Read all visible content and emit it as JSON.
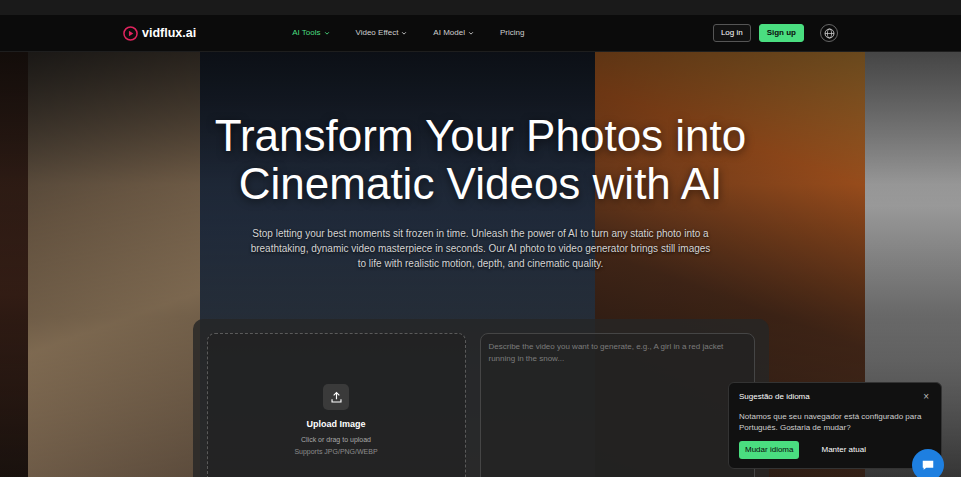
{
  "logo": {
    "text": "vidflux.ai"
  },
  "nav": [
    {
      "label": "AI Tools",
      "selected": true,
      "has_menu": true
    },
    {
      "label": "Video Effect",
      "selected": false,
      "has_menu": true
    },
    {
      "label": "AI Model",
      "selected": false,
      "has_menu": true
    },
    {
      "label": "Pricing",
      "selected": false,
      "has_menu": false
    }
  ],
  "auth": {
    "login": "Log in",
    "signup": "Sign up"
  },
  "hero": {
    "title": "Transform Your Photos into Cinematic Videos with AI",
    "subtitle": "Stop letting your best moments sit frozen in time. Unleash the power of AI to turn any static photo into a breathtaking, dynamic video masterpiece in seconds. Our AI photo to video generator brings still images to life with realistic motion, depth, and cinematic quality."
  },
  "generator": {
    "upload": {
      "title": "Upload Image",
      "hint": "Click or drag to upload",
      "formats": "Supports JPG/PNG/WEBP"
    },
    "prompt": {
      "placeholder": "Describe the video you want to generate, e.g., A girl in a red jacket running in the snow..."
    }
  },
  "language_popup": {
    "title": "Sugestão de idioma",
    "close": "×",
    "message": "Notamos que seu navegador está configurado para Português. Gostaria de mudar?",
    "buttons": [
      {
        "label": "Mudar idioma",
        "kind": "primary"
      },
      {
        "label": "Manter atual",
        "kind": "plain"
      }
    ]
  }
}
